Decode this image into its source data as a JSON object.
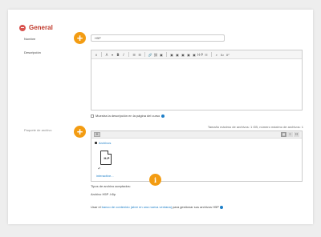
{
  "section": {
    "title": "General"
  },
  "fields": {
    "name_label": "Nombre",
    "name_value": "H5P",
    "description_label": "Descripción",
    "package_label": "Paquete de archivo"
  },
  "editor": {
    "toolbar": [
      "∨",
      "A",
      "▾",
      "B",
      "I",
      "☰",
      "☰",
      "🔗",
      "⛓",
      "▣",
      "▣",
      "▣",
      "▣",
      "▣",
      "▣",
      "H-P",
      "☷",
      "⌕",
      "x₂",
      "x²"
    ]
  },
  "checkbox": {
    "label": "Muestra la descripción en la página del curso"
  },
  "filepicker": {
    "max_size": "Tamaño máximo de archivos: 1 GB, número máximo de archivos: 1",
    "add_label": "+",
    "views": [
      "▦",
      "≡",
      "☷"
    ],
    "path_label": "Archivos",
    "file_badge": "H-P",
    "file_name": "interactive...",
    "arrow": "↶"
  },
  "accepted": {
    "title": "Tipos de archivo aceptados:",
    "value": "Archivo H5P .h5p"
  },
  "content_bank": {
    "prefix": "Usar el",
    "link": "banco de contenido (abre en una nueva ventana)",
    "suffix": "para gestionar sus archivos H5P"
  },
  "callouts": {
    "plus": "+",
    "info": "i"
  },
  "colors": {
    "accent": "#f39c12",
    "section": "#c0392b",
    "link": "#1e7fc8"
  }
}
